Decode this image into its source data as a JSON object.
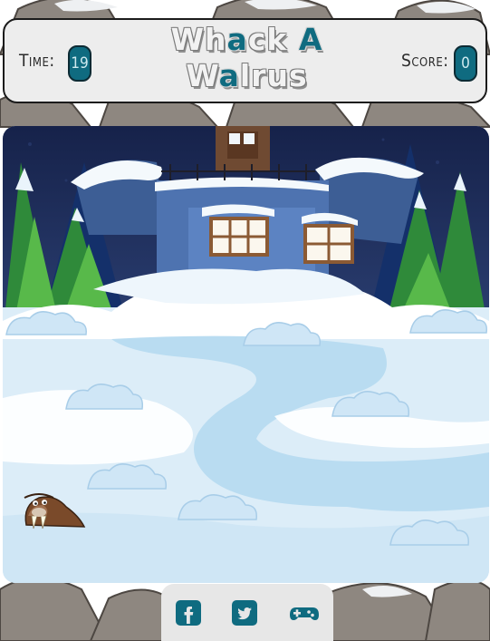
{
  "header": {
    "time_label": "Time:",
    "time_value": "19",
    "score_label": "Score:",
    "score_value": "0",
    "title_line1_a": "Wh",
    "title_line1_b": "a",
    "title_line1_c": "ck ",
    "title_line1_d": "A",
    "title_line2_a": "W",
    "title_line2_b": "a",
    "title_line2_c": "lrus"
  },
  "colors": {
    "accent": "#0f6b80",
    "header_bg": "#ededed",
    "footer_bg": "#e7e7e7",
    "snow": "#dff0fa"
  },
  "footer": {
    "icons": [
      "facebook-icon",
      "twitter-icon",
      "gamepad-icon"
    ]
  }
}
